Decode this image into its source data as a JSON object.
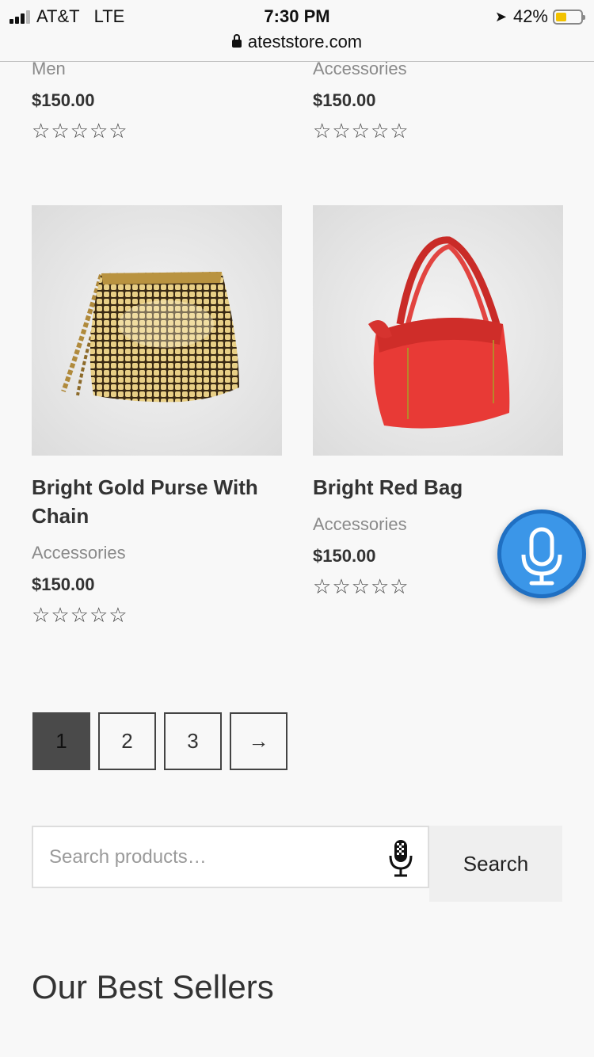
{
  "status_bar": {
    "carrier": "AT&T",
    "network": "LTE",
    "time": "7:30 PM",
    "battery": "42%",
    "battery_level": 0.42,
    "url": "ateststore.com"
  },
  "top_products": [
    {
      "category": "Men",
      "price": "$150.00",
      "rating": 0
    },
    {
      "category": "Accessories",
      "price": "$150.00",
      "rating": 0
    }
  ],
  "products": [
    {
      "title": "Bright Gold Purse With Chain",
      "category": "Accessories",
      "price": "$150.00",
      "rating": 0,
      "image": "gold-purse-image"
    },
    {
      "title": "Bright Red Bag",
      "category": "Accessories",
      "price": "$150.00",
      "rating": 0,
      "image": "red-bag-image"
    }
  ],
  "pagination": {
    "pages": [
      "1",
      "2",
      "3"
    ],
    "current": "1",
    "next_label": "→"
  },
  "search": {
    "placeholder": "Search products…",
    "button_label": "Search"
  },
  "section": {
    "best_sellers_title": "Our Best Sellers"
  },
  "icons": {
    "voice": "microphone-icon",
    "lock": "lock-icon",
    "location": "location-arrow-icon"
  },
  "colors": {
    "mic_fab": "#3b96e8",
    "active_page": "#4a4a4a",
    "battery": "#f2c200",
    "red_bag": "#e83a36",
    "gold_purse": "#c9a24a"
  }
}
